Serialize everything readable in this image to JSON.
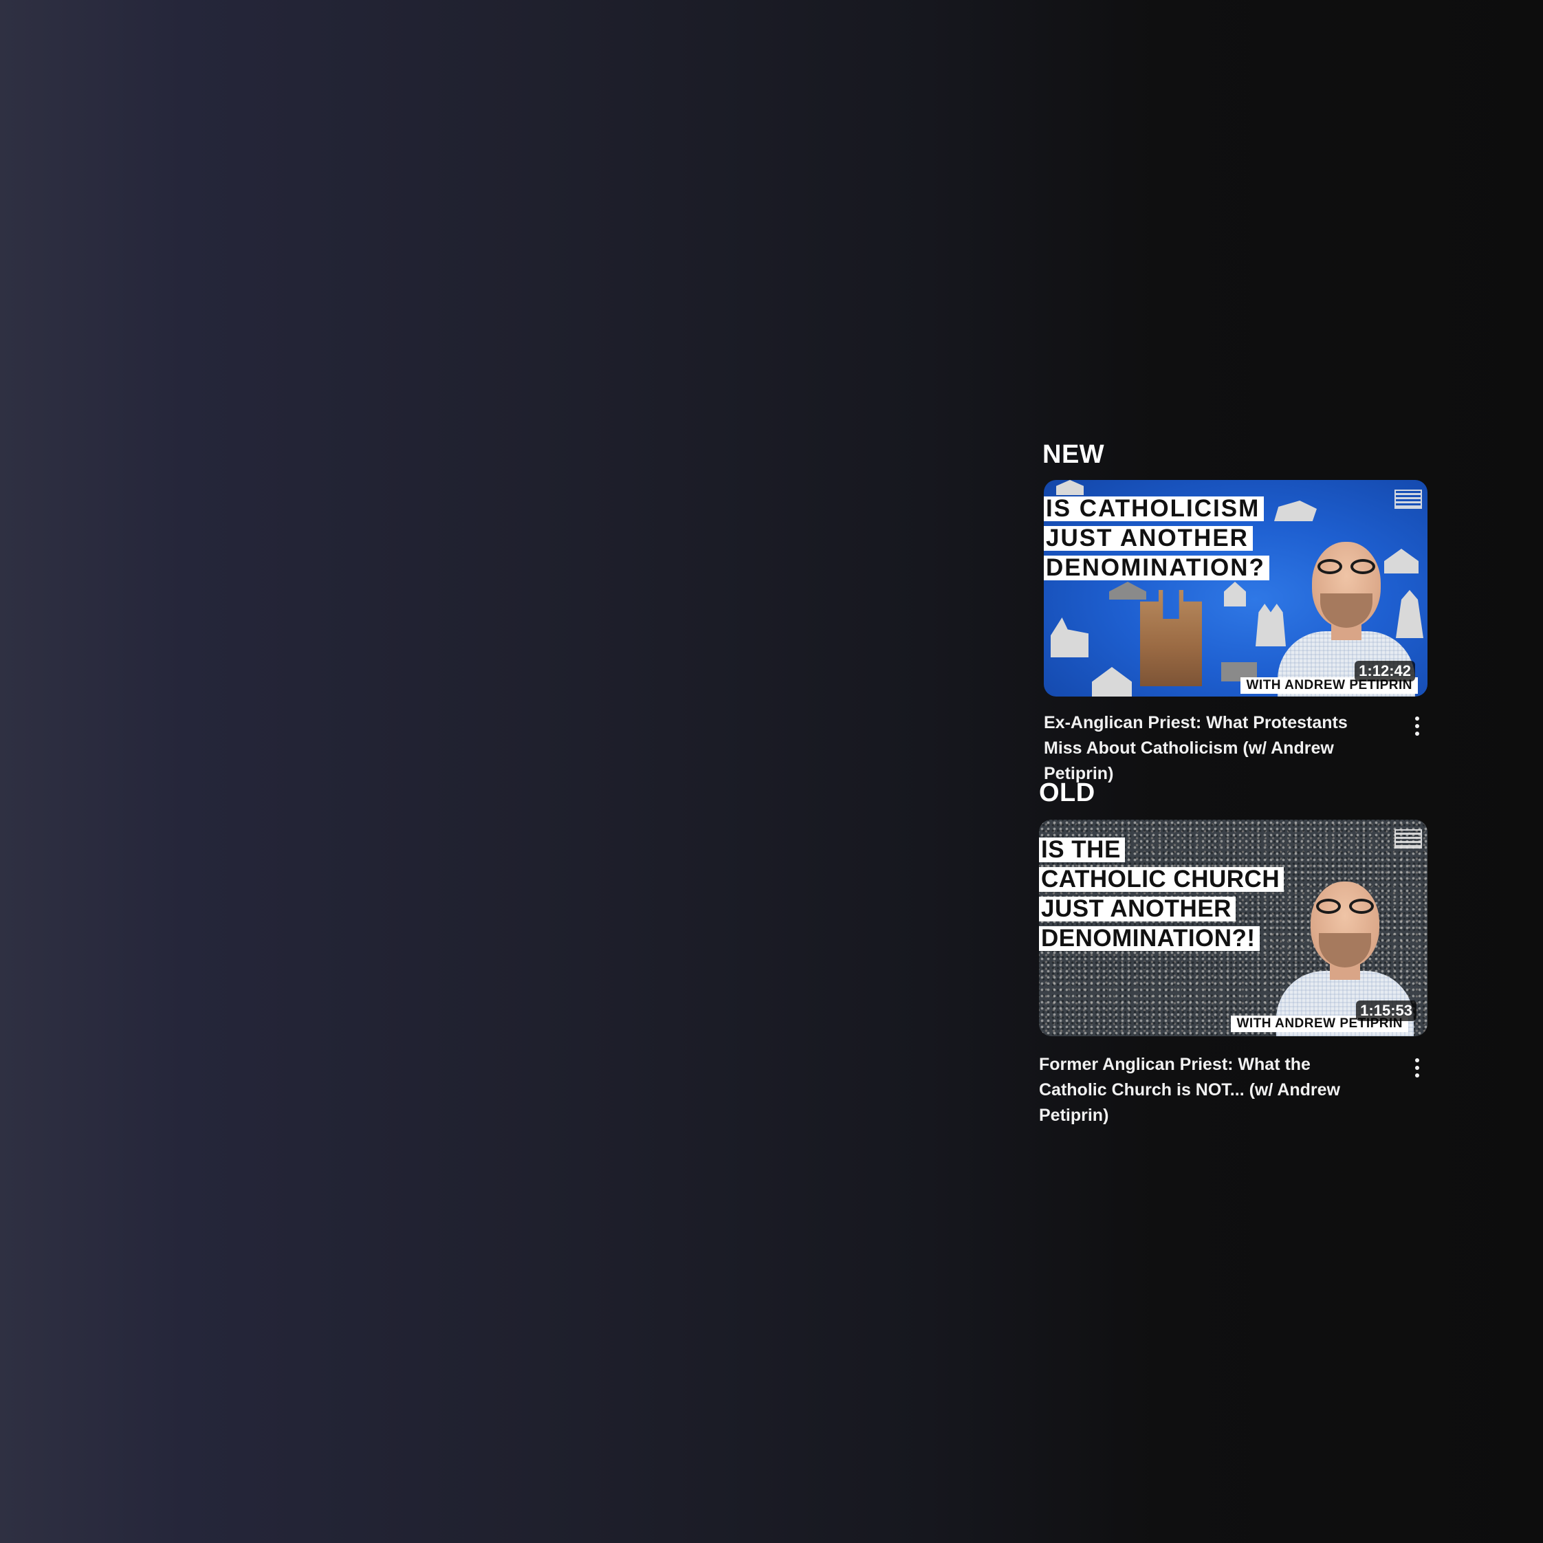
{
  "sections": {
    "new_label": "NEW",
    "old_label": "OLD"
  },
  "videos": [
    {
      "headline_lines": [
        "IS CATHOLICISM",
        "JUST ANOTHER",
        "DENOMINATION?"
      ],
      "banner": "WITH ANDREW PETIPRIN",
      "duration": "1:12:42",
      "title": "Ex-Anglican Priest: What Protestants Miss About Catholicism (w/ Andrew Petiprin)",
      "more_icon": "more-vert-icon"
    },
    {
      "headline_lines": [
        "IS THE",
        "CATHOLIC CHURCH",
        "JUST ANOTHER",
        "DENOMINATION?!"
      ],
      "banner": "WITH ANDREW PETIPRIN",
      "duration": "1:15:53",
      "title": "Former Anglican Priest: What the Catholic Church is NOT... (w/ Andrew Petiprin)",
      "more_icon": "more-vert-icon"
    }
  ],
  "colors": {
    "background_left": "#2f3042",
    "background_right": "#0d0d0d",
    "thumb_new_blue": "#1e5fd0",
    "text": "#f1f1f1"
  }
}
